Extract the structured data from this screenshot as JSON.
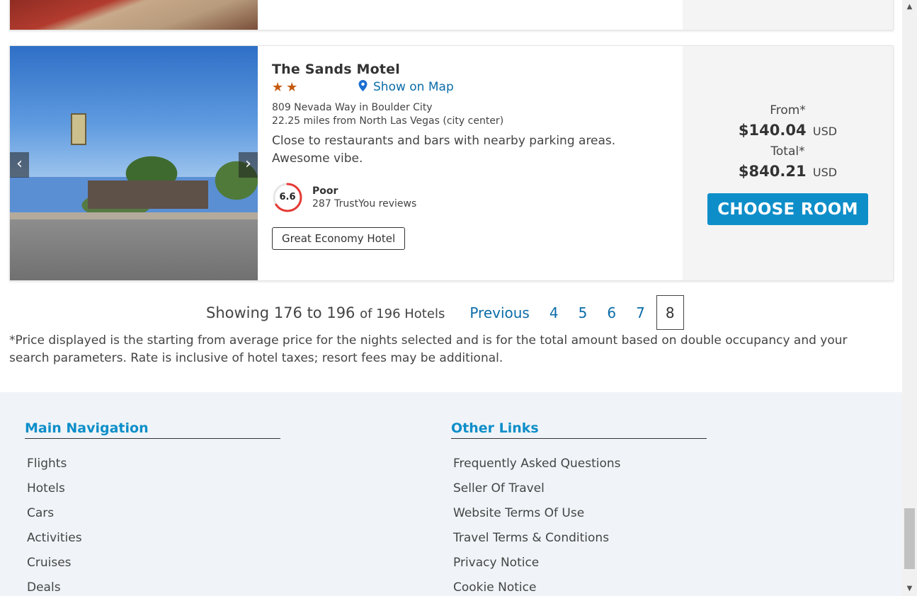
{
  "hotel": {
    "name": "The Sands Motel",
    "stars": "★★",
    "map_link": "Show on Map",
    "address": "809 Nevada Way in Boulder City",
    "distance": "22.25 miles from North Las Vegas (city center)",
    "description": "Close to restaurants and bars with nearby parking areas. Awesome vibe.",
    "rating_score": "6.6",
    "rating_fraction": 0.66,
    "rating_color": "#e53935",
    "rating_label": "Poor",
    "review_count": "287 TrustYou reviews",
    "badge": "Great Economy Hotel",
    "prev_arrow": "‹",
    "next_arrow": "›"
  },
  "price": {
    "from_label": "From*",
    "from_value": "$140.04",
    "from_currency": "USD",
    "total_label": "Total*",
    "total_value": "$840.21",
    "total_currency": "USD",
    "button": "CHOOSE ROOM"
  },
  "pagination": {
    "showing": "Showing 176 to 196",
    "of_text": "of 196 Hotels",
    "previous": "Previous",
    "pages": [
      "4",
      "5",
      "6",
      "7"
    ],
    "current": "8"
  },
  "disclaimer": "*Price displayed is the starting from average price for the nights selected and is for the total amount based on double occupancy and your search parameters. Rate is inclusive of hotel taxes; resort fees may be additional.",
  "footer": {
    "main_nav": {
      "heading": "Main Navigation",
      "links": [
        "Flights",
        "Hotels",
        "Cars",
        "Activities",
        "Cruises",
        "Deals"
      ]
    },
    "other_links": {
      "heading": "Other Links",
      "links": [
        "Frequently Asked Questions",
        "Seller Of Travel",
        "Website Terms Of Use",
        "Travel Terms & Conditions",
        "Privacy Notice",
        "Cookie Notice"
      ]
    }
  },
  "colors": {
    "accent": "#0e8ec9",
    "link": "#0b6ca8",
    "star": "#c55a11"
  }
}
